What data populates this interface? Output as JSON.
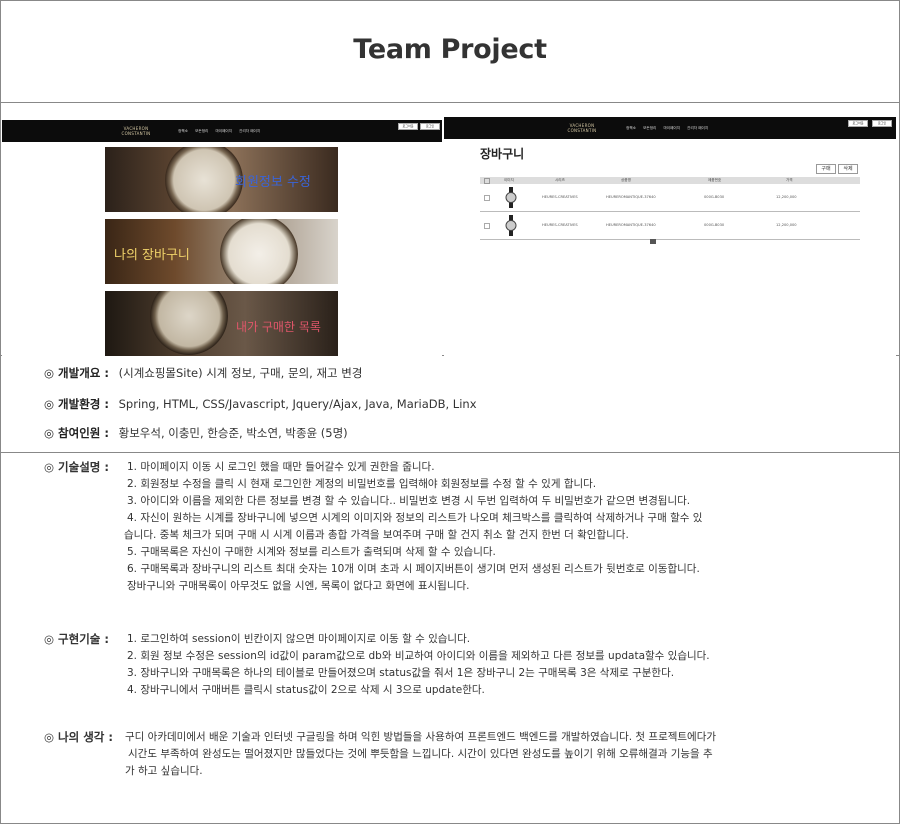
{
  "title": "Team Project",
  "left_screenshot": {
    "logo": "VACHERON CONSTANTIN",
    "nav": [
      "정책소",
      "모든정리",
      "마이페이지",
      "관리자 페이지"
    ],
    "buttons": [
      "로그아웃",
      "로그인"
    ],
    "banners": [
      "회원정보 수정",
      "나의 장바구니",
      "내가 구매한 목록"
    ],
    "colors": {
      "banner1_text": "#3a64d8",
      "banner2_text": "#f0d36a",
      "banner3_text": "#e0566a"
    }
  },
  "right_screenshot": {
    "logo": "VACHERON CONSTANTIN",
    "nav": [
      "정책소",
      "모든정리",
      "마이페이지",
      "관리자 페이지"
    ],
    "buttons": [
      "로그아웃",
      "로그인"
    ],
    "cart_title": "장바구니",
    "action_buttons": [
      "구매",
      "삭제"
    ],
    "columns": [
      "이미지",
      "시리즈",
      "상품명",
      "제품번호",
      "가격"
    ],
    "rows": [
      {
        "series": "HEURES-CREATIVES",
        "name": "HEUREROMANTIQUE-37640",
        "code": "000G-B030",
        "price": "12,200,000"
      },
      {
        "series": "HEURES-CREATIVES",
        "name": "HEUREROMANTIQUE-37640",
        "code": "000G-B030",
        "price": "12,200,000"
      }
    ]
  },
  "overview": [
    {
      "label": "◎ 개발개요 :",
      "text": "(시계쇼핑몰Site) 시계 정보, 구매, 문의, 재고 변경"
    },
    {
      "label": "◎ 개발환경 :",
      "text": "Spring, HTML, CSS/Javascript, Jquery/Ajax, Java, MariaDB, Linx"
    },
    {
      "label": "◎ 참여인원 :",
      "text": "황보우석, 이충민, 한승준, 박소연, 박종윤 (5명)"
    }
  ],
  "tech": {
    "label": "◎ 기술설명 :",
    "lines": [
      "1. 마이페이지 이동 시  로그인 했을 때만 들어갈수 있게 권한을 줍니다.",
      "2. 회원정보 수정을 클릭 시 현재 로그인한 계정의 비밀번호를 입력해야 회원정보를 수정 할 수 있게 합니다.",
      "3. 아이디와 이름을 제외한 다른 정보를 변경 할 수 있습니다.. 비밀번호 변경 시 두번 입력하여 두 비밀번호가 같으면 변경됩니다.",
      "4. 자신이 원하는 시계를 장바구니에 넣으면 시계의 이미지와 정보의 리스트가 나오며 체크박스를 클릭하여 삭제하거나 구매 할수 있",
      "습니다. 중복 체크가 되며 구매 시 시계 이름과 총합 가격을 보여주며 구매 할 건지 취소 할 건지 한번 더 확인합니다.",
      "5. 구매목록은 자신이 구매한 시계와 정보를 리스트가 출력되며 삭제 할 수 있습니다.",
      "6. 구매목록과 장바구니의 리스트 최대 숫자는 10개 이며 초과 시 페이지버튼이 생기며 먼저 생성된 리스트가 뒷번호로 이동합니다.",
      "장바구니와 구매목록이 아무것도 없을 시엔, 목록이 없다고 화면에 표시됩니다."
    ]
  },
  "impl": {
    "label": "◎ 구현기술 :",
    "lines": [
      "1. 로그인하여 session이 빈칸이지 않으면 마이페이지로 이동 할 수 있습니다.",
      "2. 회원 정보 수정은 session의 id값이 param값으로 db와 비교하여 아이디와 이름을 제외하고 다른 정보를 updata할수 있습니다.",
      "3. 장바구니와 구매목록은 하나의 테이블로 만들어졌으며 status값을 줘서 1은 장바구니 2는 구매목록 3은 삭제로 구분한다.",
      "4. 장바구니에서 구매버튼 클릭시 status값이 2으로  삭제 시 3으로 update한다."
    ]
  },
  "thoughts": {
    "label": "◎ 나의 생각 :",
    "lines": [
      "구디 아카데미에서 배운 기술과 인터넷 구글링을 하며 익힌 방법들을 사용하여 프론트엔드 백엔드를 개발하였습니다. 첫 프로젝트에다가",
      "시간도 부족하여 완성도는 떨어졌지만 많들었다는 것에 뿌듯함을 느낍니다. 시간이 있다면 완성도를 높이기 위해 오류해결과 기능을 추",
      "가 하고 싶습니다."
    ]
  }
}
